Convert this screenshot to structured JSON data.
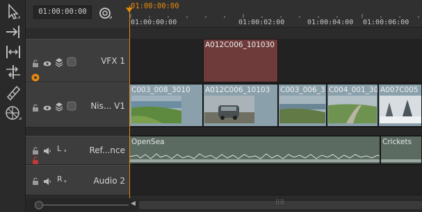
{
  "header": {
    "timecode": "01:00:00:00",
    "playhead_timecode": "01:00:00:00"
  },
  "ruler": {
    "labels": [
      "01:00:00:00",
      "01:00:02:00",
      "01:00:04:00",
      "01:00:06:00"
    ]
  },
  "tracks": [
    {
      "id": "vfx1",
      "name": "VFX 1"
    },
    {
      "id": "video1",
      "name": "Nis... V1"
    },
    {
      "id": "ref",
      "name": "Ref...nce",
      "channel": "L"
    },
    {
      "id": "audio2",
      "name": "Audio 2",
      "channel": "R"
    }
  ],
  "clips": {
    "vfx": {
      "label": "A012C006_101030"
    },
    "video": [
      {
        "label": "C003_008_3010"
      },
      {
        "label": "A012C006_10103"
      },
      {
        "label": "C003_006_3"
      },
      {
        "label": "C004_001_30"
      },
      {
        "label": "A007C005"
      }
    ],
    "audio": [
      {
        "label": "OpenSea"
      },
      {
        "label": "Crickets"
      }
    ]
  },
  "colors": {
    "accent": "#e8890c",
    "vfx_clip": "#6e3a3a",
    "video_clip": "#8aa0ab",
    "audio_clip": "#5b6b62",
    "lock_red": "#c0393b"
  }
}
